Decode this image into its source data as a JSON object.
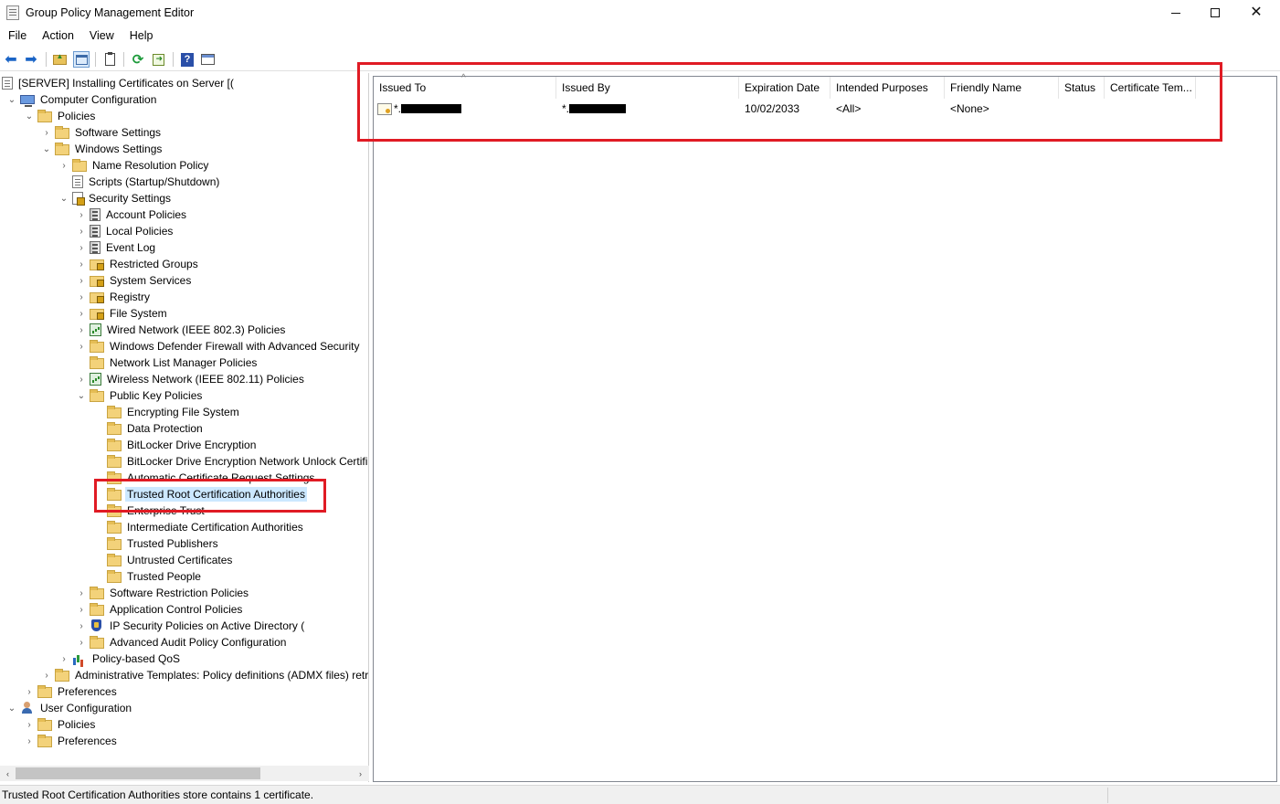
{
  "window": {
    "title": "Group Policy Management Editor",
    "controls": {
      "minimize": "minimize",
      "maximize": "maximize",
      "close": "✕"
    }
  },
  "menu": [
    "File",
    "Action",
    "View",
    "Help"
  ],
  "toolbar": {
    "icons": [
      "back-arrow-icon",
      "forward-arrow-icon",
      "up-folder-icon",
      "show-hide-tree-icon",
      "export-list-icon",
      "refresh-icon",
      "export-icon",
      "help-icon",
      "properties-icon"
    ]
  },
  "tree": [
    {
      "label": "[SERVER] Installing Certificates on Server [(",
      "chevron": "",
      "icon": "doc"
    },
    {
      "label": "Computer Configuration",
      "chevron": "⌄",
      "icon": "computer"
    },
    {
      "label": "Policies",
      "chevron": "⌄",
      "icon": "folder"
    },
    {
      "label": "Software Settings",
      "chevron": "›",
      "icon": "folder"
    },
    {
      "label": "Windows Settings",
      "chevron": "⌄",
      "icon": "folder"
    },
    {
      "label": "Name Resolution Policy",
      "chevron": "›",
      "icon": "folder"
    },
    {
      "label": "Scripts (Startup/Shutdown)",
      "chevron": "",
      "icon": "doc"
    },
    {
      "label": "Security Settings",
      "chevron": "⌄",
      "icon": "secset"
    },
    {
      "label": "Account Policies",
      "chevron": "›",
      "icon": "server"
    },
    {
      "label": "Local Policies",
      "chevron": "›",
      "icon": "server"
    },
    {
      "label": "Event Log",
      "chevron": "›",
      "icon": "server"
    },
    {
      "label": "Restricted Groups",
      "chevron": "›",
      "icon": "folder-lock"
    },
    {
      "label": "System Services",
      "chevron": "›",
      "icon": "folder-lock"
    },
    {
      "label": "Registry",
      "chevron": "›",
      "icon": "folder-lock"
    },
    {
      "label": "File System",
      "chevron": "›",
      "icon": "folder-lock"
    },
    {
      "label": "Wired Network (IEEE 802.3) Policies",
      "chevron": "›",
      "icon": "network"
    },
    {
      "label": "Windows Defender Firewall with Advanced Security",
      "chevron": "›",
      "icon": "folder"
    },
    {
      "label": "Network List Manager Policies",
      "chevron": "",
      "icon": "folder"
    },
    {
      "label": "Wireless Network (IEEE 802.11) Policies",
      "chevron": "›",
      "icon": "network"
    },
    {
      "label": "Public Key Policies",
      "chevron": "⌄",
      "icon": "folder"
    },
    {
      "label": "Encrypting File System",
      "chevron": "",
      "icon": "folder"
    },
    {
      "label": "Data Protection",
      "chevron": "",
      "icon": "folder"
    },
    {
      "label": "BitLocker Drive Encryption",
      "chevron": "",
      "icon": "folder"
    },
    {
      "label": "BitLocker Drive Encryption Network Unlock Certifi",
      "chevron": "",
      "icon": "folder"
    },
    {
      "label": "Automatic Certificate Request Settings",
      "chevron": "",
      "icon": "folder"
    },
    {
      "label": "Trusted Root Certification Authorities",
      "chevron": "",
      "icon": "folder"
    },
    {
      "label": "Enterprise Trust",
      "chevron": "",
      "icon": "folder"
    },
    {
      "label": "Intermediate Certification Authorities",
      "chevron": "",
      "icon": "folder"
    },
    {
      "label": "Trusted Publishers",
      "chevron": "",
      "icon": "folder"
    },
    {
      "label": "Untrusted Certificates",
      "chevron": "",
      "icon": "folder"
    },
    {
      "label": "Trusted People",
      "chevron": "",
      "icon": "folder"
    },
    {
      "label": "Software Restriction Policies",
      "chevron": "›",
      "icon": "folder"
    },
    {
      "label": "Application Control Policies",
      "chevron": "›",
      "icon": "folder"
    },
    {
      "label": "IP Security Policies on Active Directory (",
      "chevron": "›",
      "icon": "shield"
    },
    {
      "label": "Advanced Audit Policy Configuration",
      "chevron": "›",
      "icon": "folder"
    },
    {
      "label": "Policy-based QoS",
      "chevron": "›",
      "icon": "chart"
    },
    {
      "label": "Administrative Templates: Policy definitions (ADMX files) retr",
      "chevron": "›",
      "icon": "folder"
    },
    {
      "label": "Preferences",
      "chevron": "›",
      "icon": "folder"
    },
    {
      "label": "User Configuration",
      "chevron": "⌄",
      "icon": "user"
    },
    {
      "label": "Policies",
      "chevron": "›",
      "icon": "folder"
    },
    {
      "label": "Preferences",
      "chevron": "›",
      "icon": "folder"
    }
  ],
  "scrollbar": {
    "left_arrow": "‹",
    "right_arrow": "›"
  },
  "columns": [
    "Issued To",
    "Issued By",
    "Expiration Date",
    "Intended Purposes",
    "Friendly Name",
    "Status",
    "Certificate Tem..."
  ],
  "sort_indicator": "^",
  "rows": [
    {
      "issued_to": "*.",
      "issued_by": "*.",
      "expiration": "10/02/2033",
      "purposes": "<All>",
      "friendly": "<None>",
      "status": "",
      "template": ""
    }
  ],
  "status": {
    "text": "Trusted Root Certification Authorities store contains 1 certificate."
  },
  "annotation_color": "#e01b24"
}
